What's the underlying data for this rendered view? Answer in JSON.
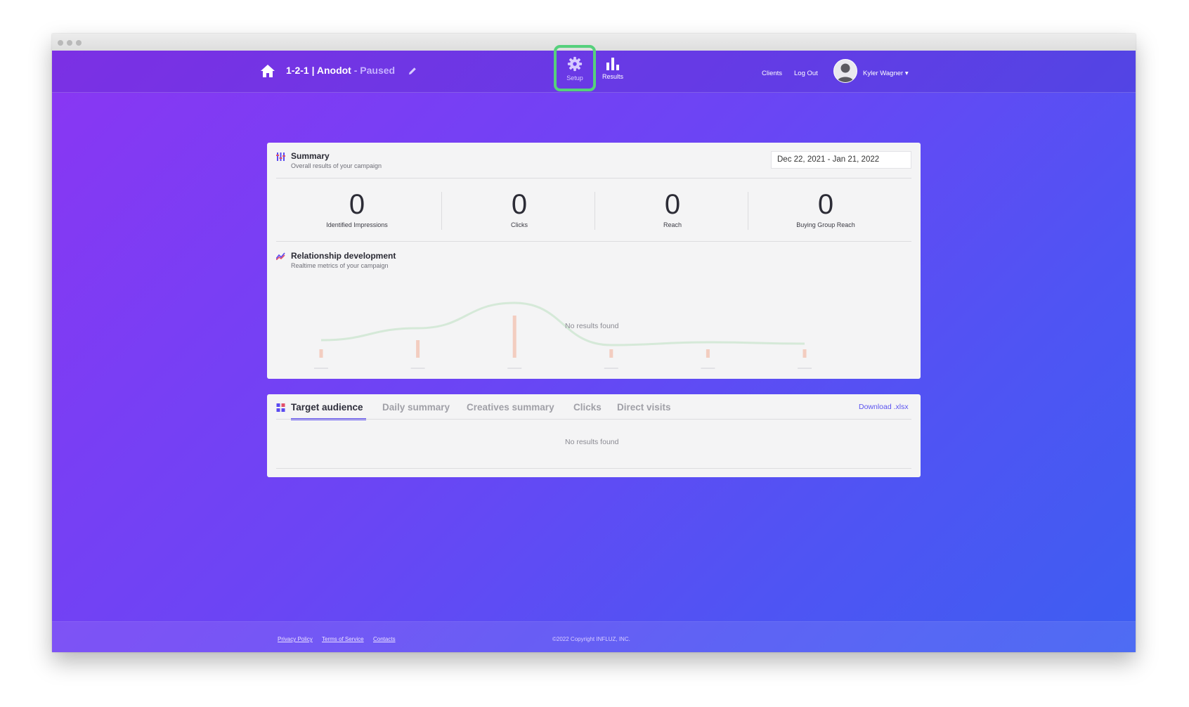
{
  "topbar": {
    "campaign_name": "1-2-1 | Anodot",
    "campaign_status": "- Paused",
    "nav_setup_label": "Setup",
    "nav_results_label": "Results",
    "clients_label": "Clients",
    "logout_label": "Log Out",
    "user_name": "Kyler Wagner",
    "user_caret": "▾"
  },
  "summary": {
    "title": "Summary",
    "subtitle": "Overall results of your campaign",
    "date_range": "Dec 22, 2021 - Jan 21, 2022",
    "stats": [
      {
        "value": "0",
        "label": "Identified Impressions"
      },
      {
        "value": "0",
        "label": "Clicks"
      },
      {
        "value": "0",
        "label": "Reach"
      },
      {
        "value": "0",
        "label": "Buying Group Reach"
      }
    ]
  },
  "relationship": {
    "title": "Relationship development",
    "subtitle": "Realtime metrics of your campaign",
    "no_results": "No results found"
  },
  "chart_data": {
    "type": "line",
    "title": "",
    "xlabel": "",
    "ylabel": "",
    "categories": [
      "",
      "",
      "",
      "",
      "",
      ""
    ],
    "series": [
      {
        "values": [
          0.25,
          0.42,
          0.78,
          0.18,
          0.22,
          0.2
        ]
      },
      {
        "values": [
          0.12,
          0.25,
          0.6,
          0.12,
          0.12,
          0.12
        ]
      }
    ],
    "ylim": [
      0,
      1
    ],
    "grid": false,
    "colors": [
      "#cfe6d2",
      "#f2c3b3"
    ]
  },
  "audience": {
    "tabs": [
      {
        "label": "Target audience",
        "active": true
      },
      {
        "label": "Daily summary",
        "active": false
      },
      {
        "label": "Creatives summary",
        "active": false
      },
      {
        "label": "Clicks",
        "active": false
      },
      {
        "label": "Direct visits",
        "active": false
      }
    ],
    "download_label": "Download .xlsx",
    "no_results": "No results found"
  },
  "footer": {
    "privacy": "Privacy Policy",
    "terms": "Terms of Service",
    "contacts": "Contacts",
    "copyright": "©2022 Copyright INFLUZ, INC."
  },
  "colors": {
    "accent": "#5a4af0",
    "highlight": "#56d07c",
    "gradient_start": "#8a36f3",
    "gradient_end": "#3d5ef2"
  }
}
